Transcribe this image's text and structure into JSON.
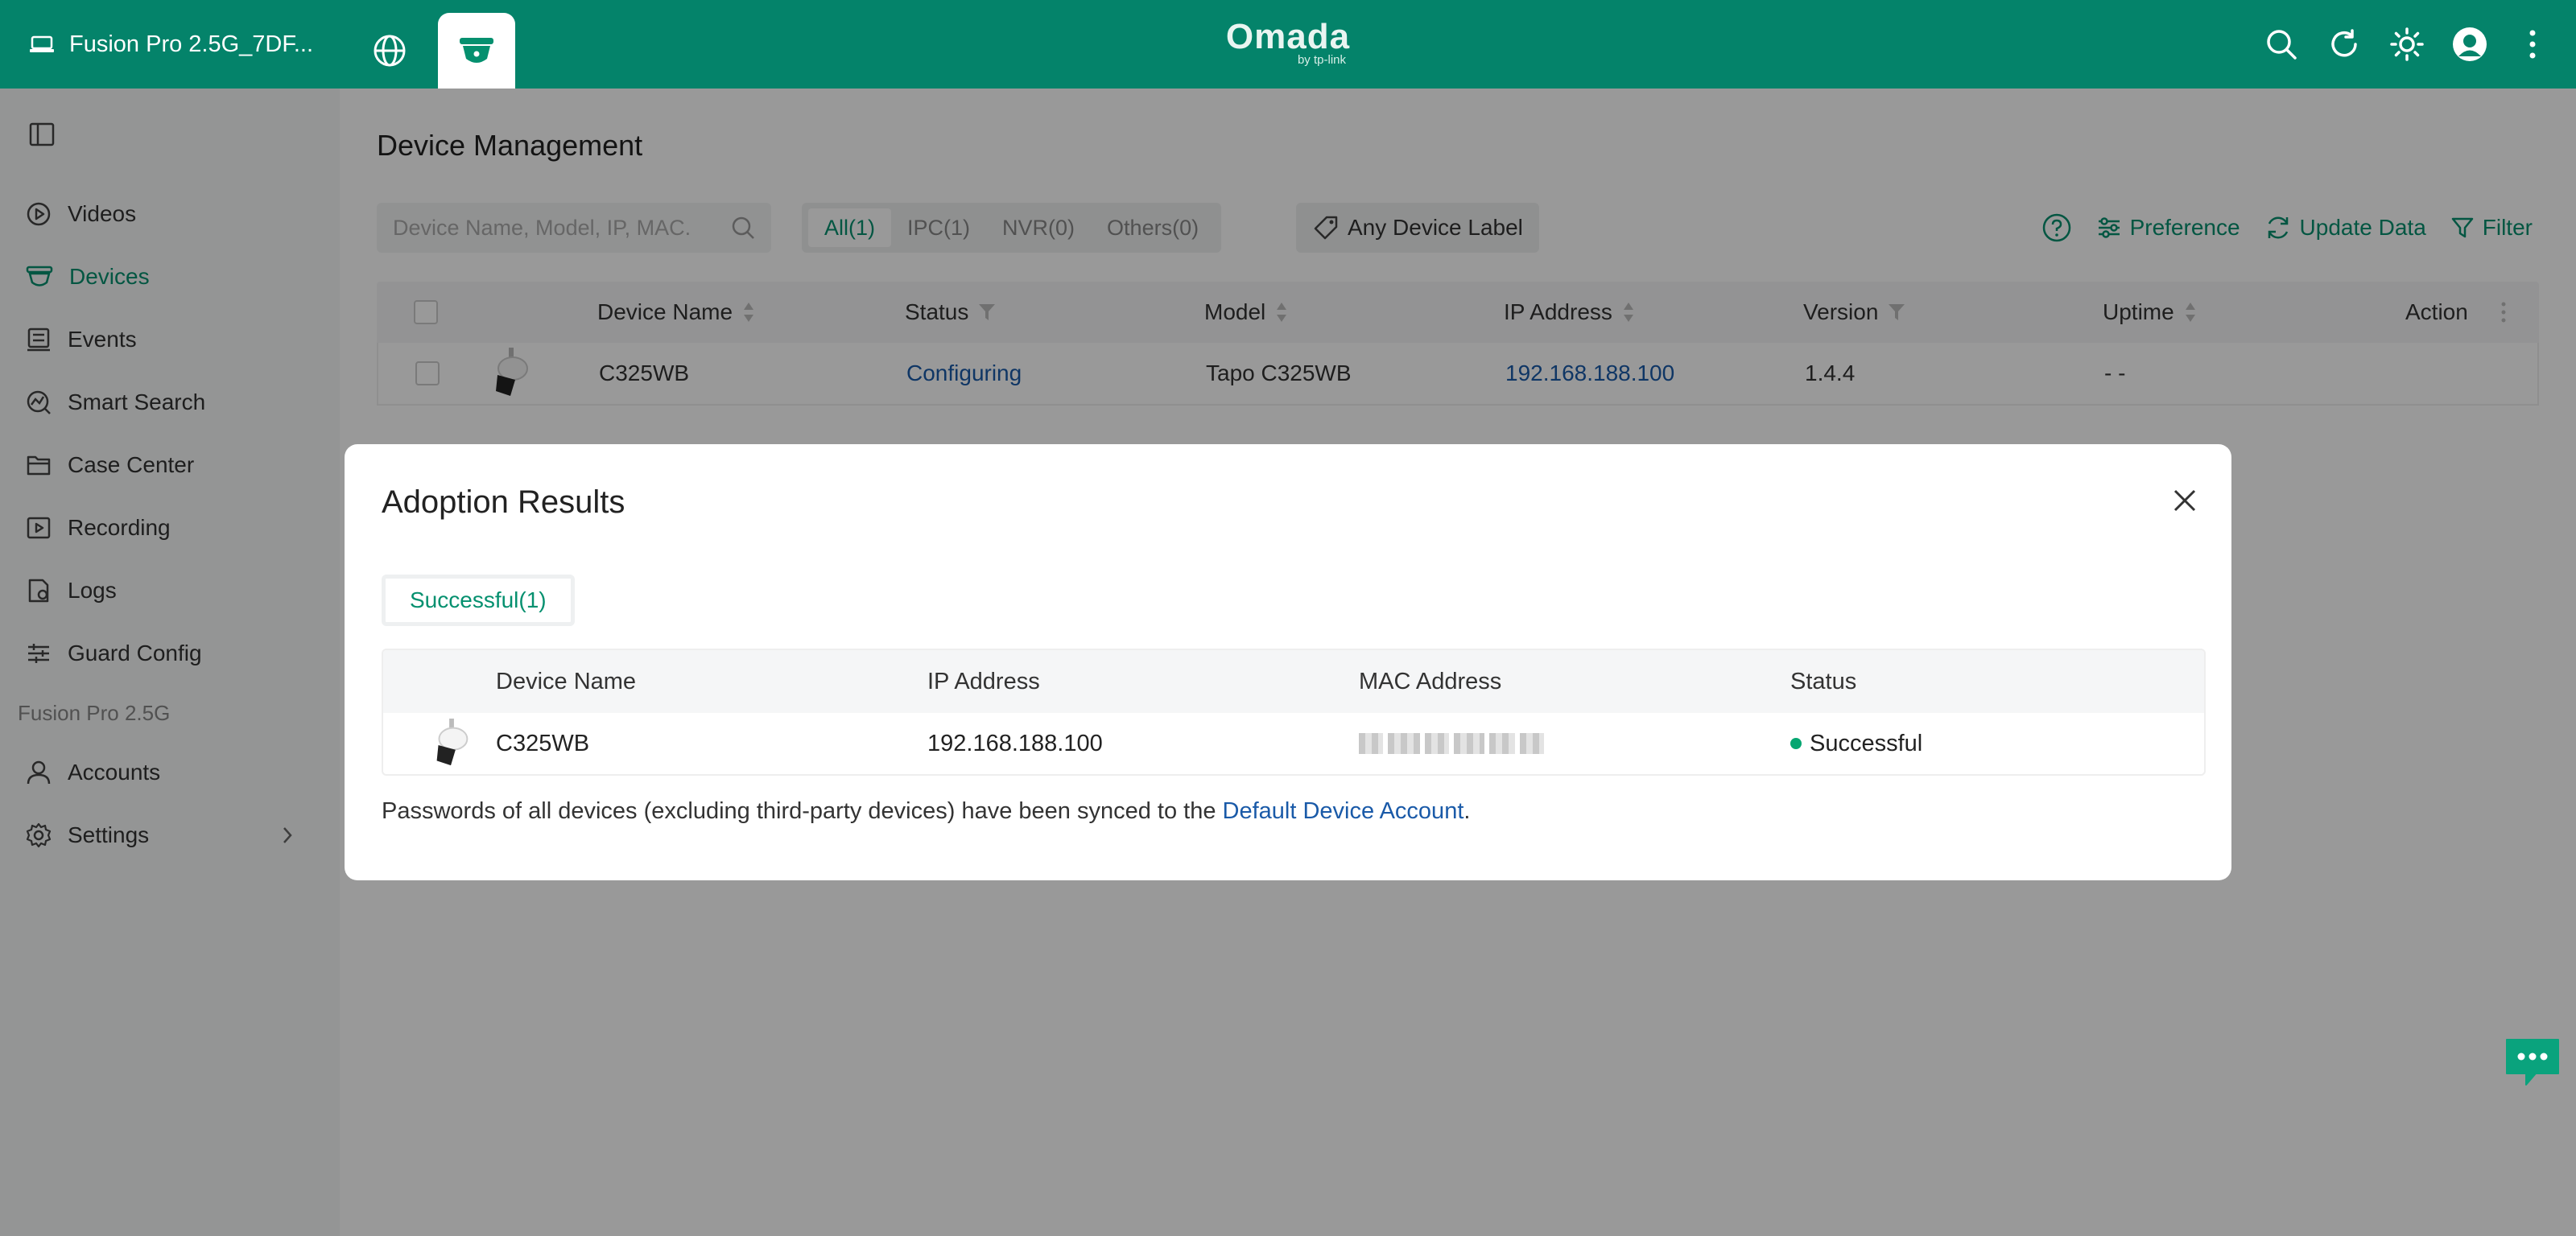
{
  "header": {
    "site_name": "Fusion Pro 2.5G_7DF...",
    "logo": {
      "brand": "Omada",
      "byline": "by tp-link"
    },
    "icons": [
      "monitor-icon",
      "globe-icon",
      "guard-camera-icon",
      "search-icon",
      "refresh-icon",
      "theme-sun-icon",
      "avatar-icon",
      "more-vertical-icon"
    ]
  },
  "sidebar": {
    "items": [
      {
        "label": "Videos",
        "icon": "play-circle-icon"
      },
      {
        "label": "Devices",
        "icon": "camera-icon",
        "active": true
      },
      {
        "label": "Events",
        "icon": "events-list-icon"
      },
      {
        "label": "Smart Search",
        "icon": "smart-search-icon"
      },
      {
        "label": "Case Center",
        "icon": "folder-icon"
      },
      {
        "label": "Recording",
        "icon": "recording-icon"
      },
      {
        "label": "Logs",
        "icon": "logs-icon"
      },
      {
        "label": "Guard Config",
        "icon": "sliders-icon"
      }
    ],
    "group_label": "Fusion Pro 2.5G",
    "bottom_items": [
      {
        "label": "Accounts",
        "icon": "user-icon"
      },
      {
        "label": "Settings",
        "icon": "gear-icon"
      }
    ]
  },
  "main": {
    "title": "Device Management",
    "search_placeholder": "Device Name, Model, IP, MAC.",
    "segments": [
      "All(1)",
      "IPC(1)",
      "NVR(0)",
      "Others(0)"
    ],
    "label_filter": "Any Device Label",
    "toolbar": {
      "preference": "Preference",
      "update": "Update Data",
      "filter": "Filter"
    },
    "table": {
      "columns": [
        "Device Name",
        "Status",
        "Model",
        "IP Address",
        "Version",
        "Uptime",
        "Action"
      ],
      "rows": [
        {
          "name": "C325WB",
          "status": "Configuring",
          "model": "Tapo C325WB",
          "ip": "192.168.188.100",
          "version": "1.4.4",
          "uptime": "- -"
        }
      ]
    }
  },
  "modal": {
    "title": "Adoption Results",
    "tab": "Successful(1)",
    "columns": [
      "Device Name",
      "IP Address",
      "MAC Address",
      "Status"
    ],
    "rows": [
      {
        "name": "C325WB",
        "ip": "192.168.188.100",
        "status": "Successful"
      }
    ],
    "note_prefix": "Passwords of all devices (excluding third-party devices) have been synced to the ",
    "note_link": "Default Device Account",
    "note_suffix": "."
  },
  "colors": {
    "accent": "#05906f",
    "header_bg": "#04836a",
    "link": "#1a5aa8",
    "success": "#05a671"
  }
}
